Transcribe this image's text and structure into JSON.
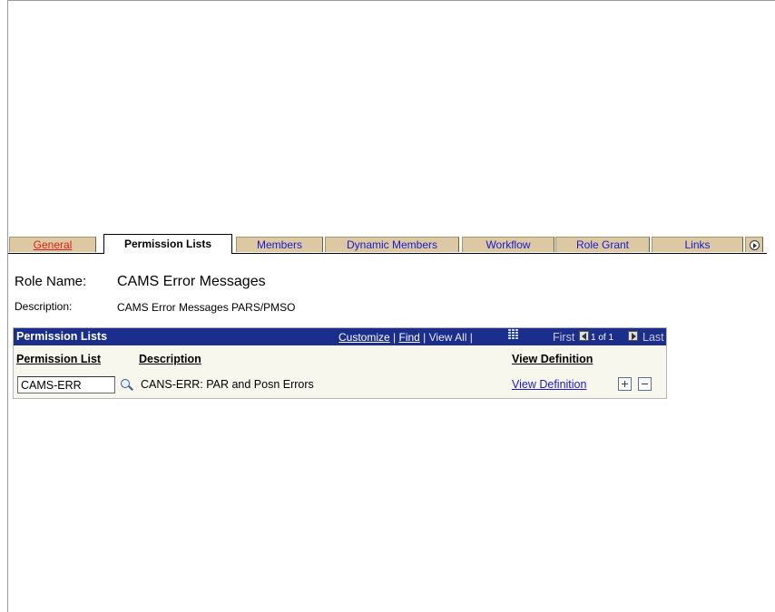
{
  "tabs": [
    {
      "label": "General",
      "state": "link"
    },
    {
      "label": "Permission Lists",
      "state": "active"
    },
    {
      "label": "Members",
      "state": "inactive"
    },
    {
      "label": "Dynamic Members",
      "state": "inactive"
    },
    {
      "label": "Workflow",
      "state": "inactive"
    },
    {
      "label": "Role Grant",
      "state": "inactive"
    },
    {
      "label": "Links",
      "state": "inactive"
    }
  ],
  "tab_scroll_icon": "chevron-right-icon",
  "role": {
    "name_label": "Role Name:",
    "name_value": "CAMS Error Messages",
    "desc_label": "Description:",
    "desc_value": "CAMS Error Messages PARS/PMSO"
  },
  "grid": {
    "title": "Permission Lists",
    "customize": "Customize",
    "sep1": " | ",
    "find": "Find",
    "sep2": " | ",
    "view_all": "View All",
    "sep3": " | ",
    "first": "First",
    "count": "1 of 1",
    "last": "Last",
    "columns": {
      "permission_list": "Permission List",
      "description": "Description",
      "view_definition": "View Definition"
    },
    "rows": [
      {
        "permission_list": "CAMS-ERR",
        "description": "CANS-ERR: PAR and Posn Errors",
        "view_definition": "View Definition"
      }
    ]
  },
  "colors": {
    "header_bg": "#1b2e8c",
    "tab_bg": "#dcc9a3",
    "link": "#1a1acc",
    "active_link": "#e0201a"
  }
}
